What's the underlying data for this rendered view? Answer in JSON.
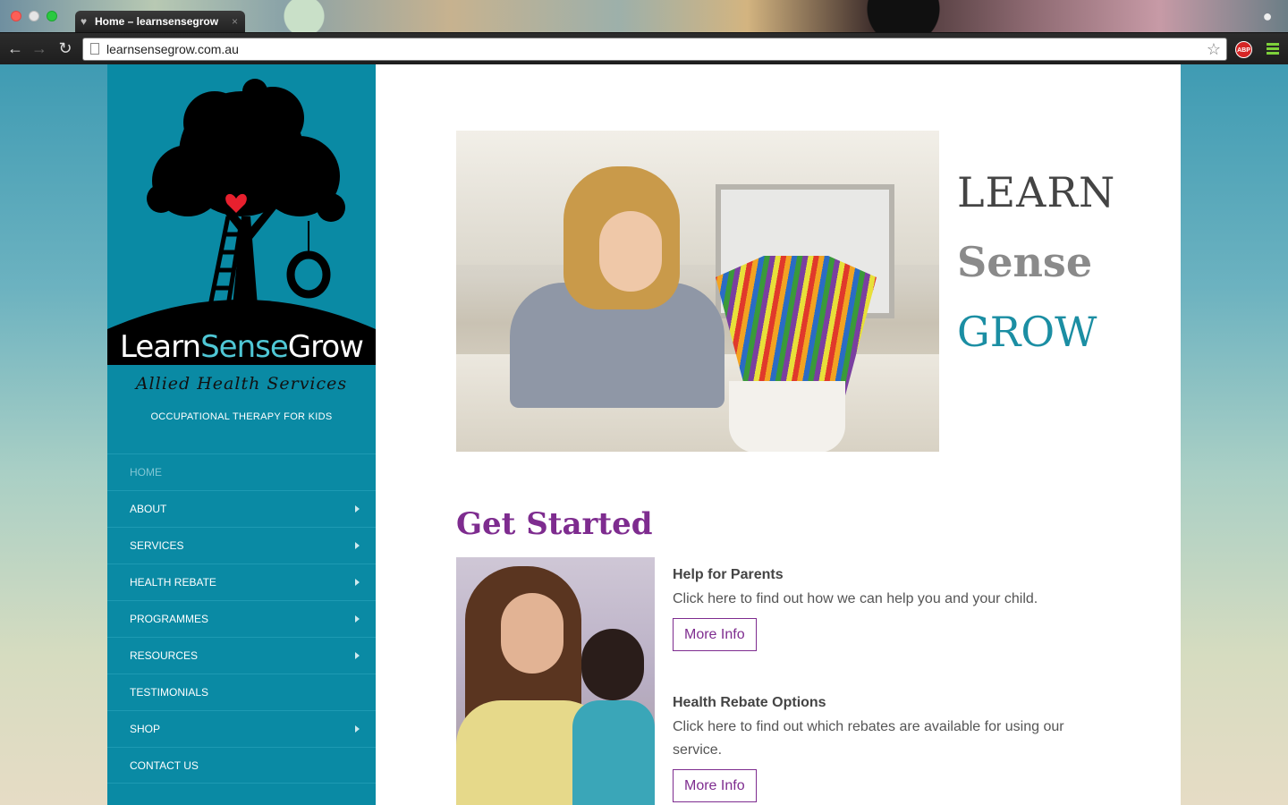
{
  "browser": {
    "tab_title": "Home – learnsensegrow",
    "tab_close": "×",
    "url": "learnsensegrow.com.au",
    "star_icon": "☆",
    "abp_label": "ABP",
    "back_icon": "←",
    "forward_icon": "→",
    "reload_icon": "↻"
  },
  "sidebar": {
    "logo": {
      "learn": "Learn",
      "sense": "Sense",
      "grow": "Grow",
      "subtitle": "Allied Health Services"
    },
    "tagline": "OCCUPATIONAL THERAPY FOR KIDS",
    "menu": [
      {
        "label": "HOME",
        "has_submenu": false,
        "active": true
      },
      {
        "label": "ABOUT",
        "has_submenu": true,
        "active": false
      },
      {
        "label": "SERVICES",
        "has_submenu": true,
        "active": false
      },
      {
        "label": "HEALTH REBATE",
        "has_submenu": true,
        "active": false
      },
      {
        "label": "PROGRAMMES",
        "has_submenu": true,
        "active": false
      },
      {
        "label": "RESOURCES",
        "has_submenu": true,
        "active": false
      },
      {
        "label": "TESTIMONIALS",
        "has_submenu": false,
        "active": false
      },
      {
        "label": "SHOP",
        "has_submenu": true,
        "active": false
      },
      {
        "label": "CONTACT US",
        "has_submenu": false,
        "active": false
      }
    ]
  },
  "hero": {
    "word_learn": "LEARN",
    "word_sense": "Sense",
    "word_grow": "GROW"
  },
  "get_started": {
    "title": "Get Started",
    "items": [
      {
        "heading": "Help for Parents",
        "text": "Click here to find out how we can help you and your child.",
        "button": "More Info"
      },
      {
        "heading": "Health Rebate Options",
        "text": "Click here to find out which rebates are available for using our service.",
        "button": "More Info"
      }
    ]
  },
  "colors": {
    "sidebar_bg": "#0a8aa4",
    "accent_purple": "#7e2c8f",
    "grow_teal": "#1b8ea3"
  }
}
